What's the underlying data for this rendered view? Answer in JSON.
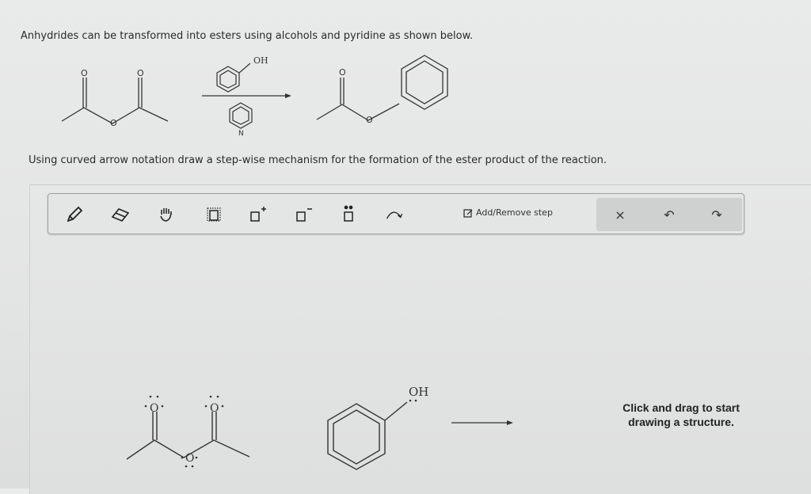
{
  "question": {
    "intro": "Anhydrides can be transformed into esters using alcohols and pyridine as shown below.",
    "instruction": "Using curved arrow notation draw a step-wise mechanism for the formation of the ester product of the reaction."
  },
  "reaction_scheme": {
    "reagent_label_oh": "OH",
    "pyridine_label_n": "N",
    "o_label": "O"
  },
  "toolbar": {
    "tools": [
      "pencil-icon",
      "eraser-icon",
      "hand-icon",
      "selection-box-icon",
      "positive-charge-icon",
      "negative-charge-icon",
      "lone-pair-icon",
      "curved-arrow-icon"
    ],
    "add_remove_step": "Add/Remove step",
    "close_symbol": "×",
    "undo_symbol": "↶",
    "redo_symbol": "↷"
  },
  "canvas": {
    "o_label": "O",
    "oh_label": "OH",
    "hint": "Click and drag to start drawing a structure."
  }
}
